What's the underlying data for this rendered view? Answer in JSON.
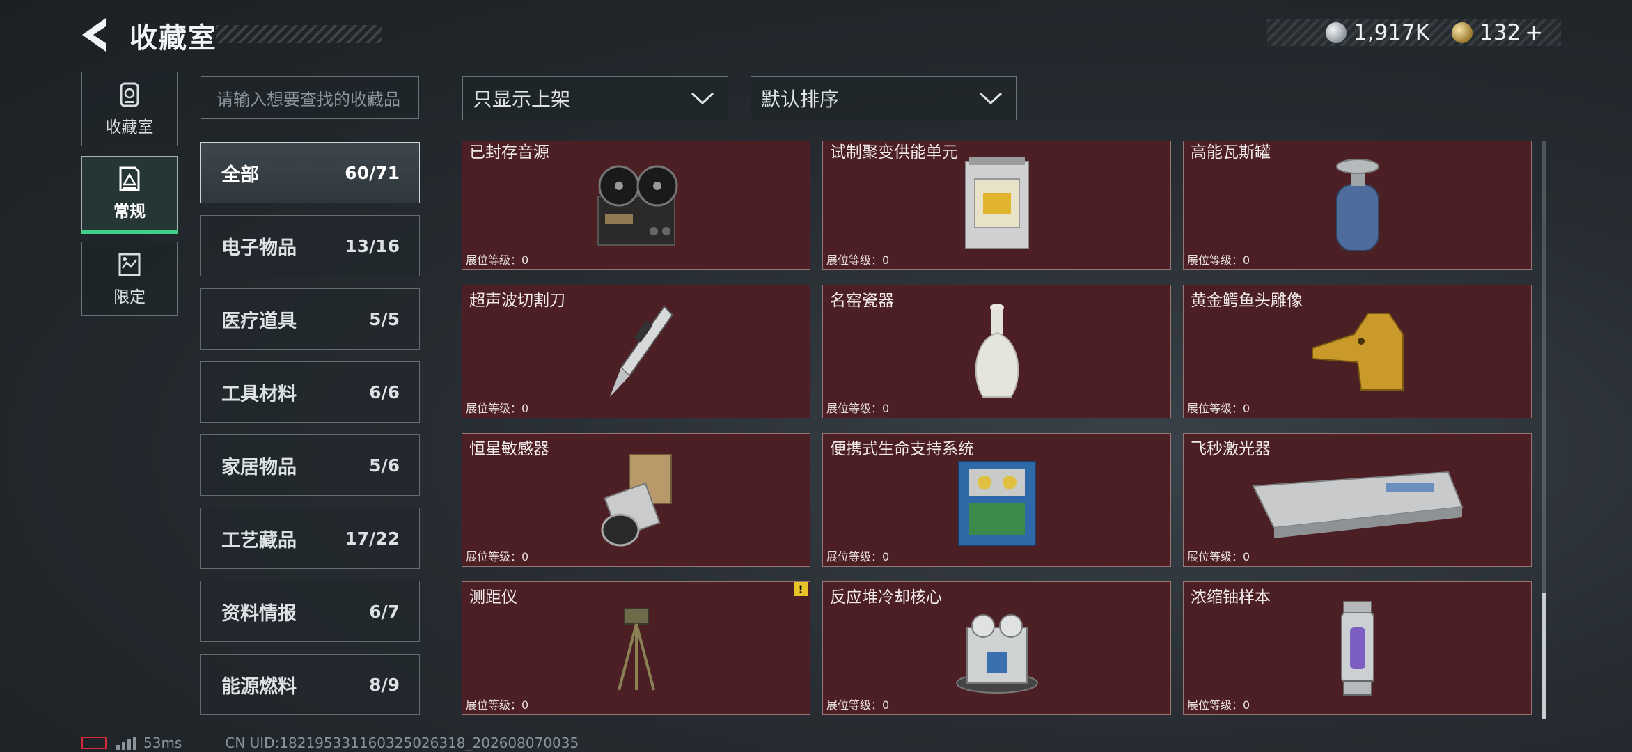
{
  "header": {
    "title": "收藏室",
    "currencies": [
      {
        "icon": "silver-coin-icon",
        "value": "1,917K"
      },
      {
        "icon": "gold-coin-icon",
        "value": "132"
      }
    ],
    "add_label": "+"
  },
  "nav": {
    "tabs": [
      {
        "label": "收藏室",
        "icon": "collection-room-icon",
        "active": false
      },
      {
        "label": "常规",
        "icon": "regular-icon",
        "active": true
      },
      {
        "label": "限定",
        "icon": "limited-icon",
        "active": false
      }
    ]
  },
  "search": {
    "placeholder": "请输入想要查找的收藏品"
  },
  "filters": {
    "show_filter": "只显示上架",
    "sort": "默认排序"
  },
  "categories": [
    {
      "name": "全部",
      "count": "60/71",
      "active": true
    },
    {
      "name": "电子物品",
      "count": "13/16"
    },
    {
      "name": "医疗道具",
      "count": "5/5"
    },
    {
      "name": "工具材料",
      "count": "6/6"
    },
    {
      "name": "家居物品",
      "count": "5/6"
    },
    {
      "name": "工艺藏品",
      "count": "17/22"
    },
    {
      "name": "资料情报",
      "count": "6/7"
    },
    {
      "name": "能源燃料",
      "count": "8/9"
    }
  ],
  "items": [
    {
      "name": "已封存音源",
      "level": "展位等级：0",
      "icon": "reel-tape-recorder-icon"
    },
    {
      "name": "试制聚变供能单元",
      "level": "展位等级：0",
      "icon": "fusion-unit-icon"
    },
    {
      "name": "高能瓦斯罐",
      "level": "展位等级：0",
      "icon": "gas-canister-icon"
    },
    {
      "name": "超声波切割刀",
      "level": "展位等级：0",
      "icon": "ultrasonic-cutter-icon"
    },
    {
      "name": "名窑瓷器",
      "level": "展位等级：0",
      "icon": "porcelain-vase-icon"
    },
    {
      "name": "黄金鳄鱼头雕像",
      "level": "展位等级：0",
      "icon": "golden-crocodile-statue-icon"
    },
    {
      "name": "恒星敏感器",
      "level": "展位等级：0",
      "icon": "star-sensor-icon"
    },
    {
      "name": "便携式生命支持系统",
      "level": "展位等级：0",
      "icon": "life-support-system-icon"
    },
    {
      "name": "飞秒激光器",
      "level": "展位等级：0",
      "icon": "femtosecond-laser-icon"
    },
    {
      "name": "测距仪",
      "level": "展位等级：0",
      "icon": "rangefinder-tripod-icon",
      "alert": "!"
    },
    {
      "name": "反应堆冷却核心",
      "level": "展位等级：0",
      "icon": "reactor-cooling-core-icon"
    },
    {
      "name": "浓缩铀样本",
      "level": "展位等级：0",
      "icon": "uranium-sample-icon"
    }
  ],
  "footer": {
    "ping": "53ms",
    "uid": "CN UID:1821953311603250​26318_202608070035"
  }
}
